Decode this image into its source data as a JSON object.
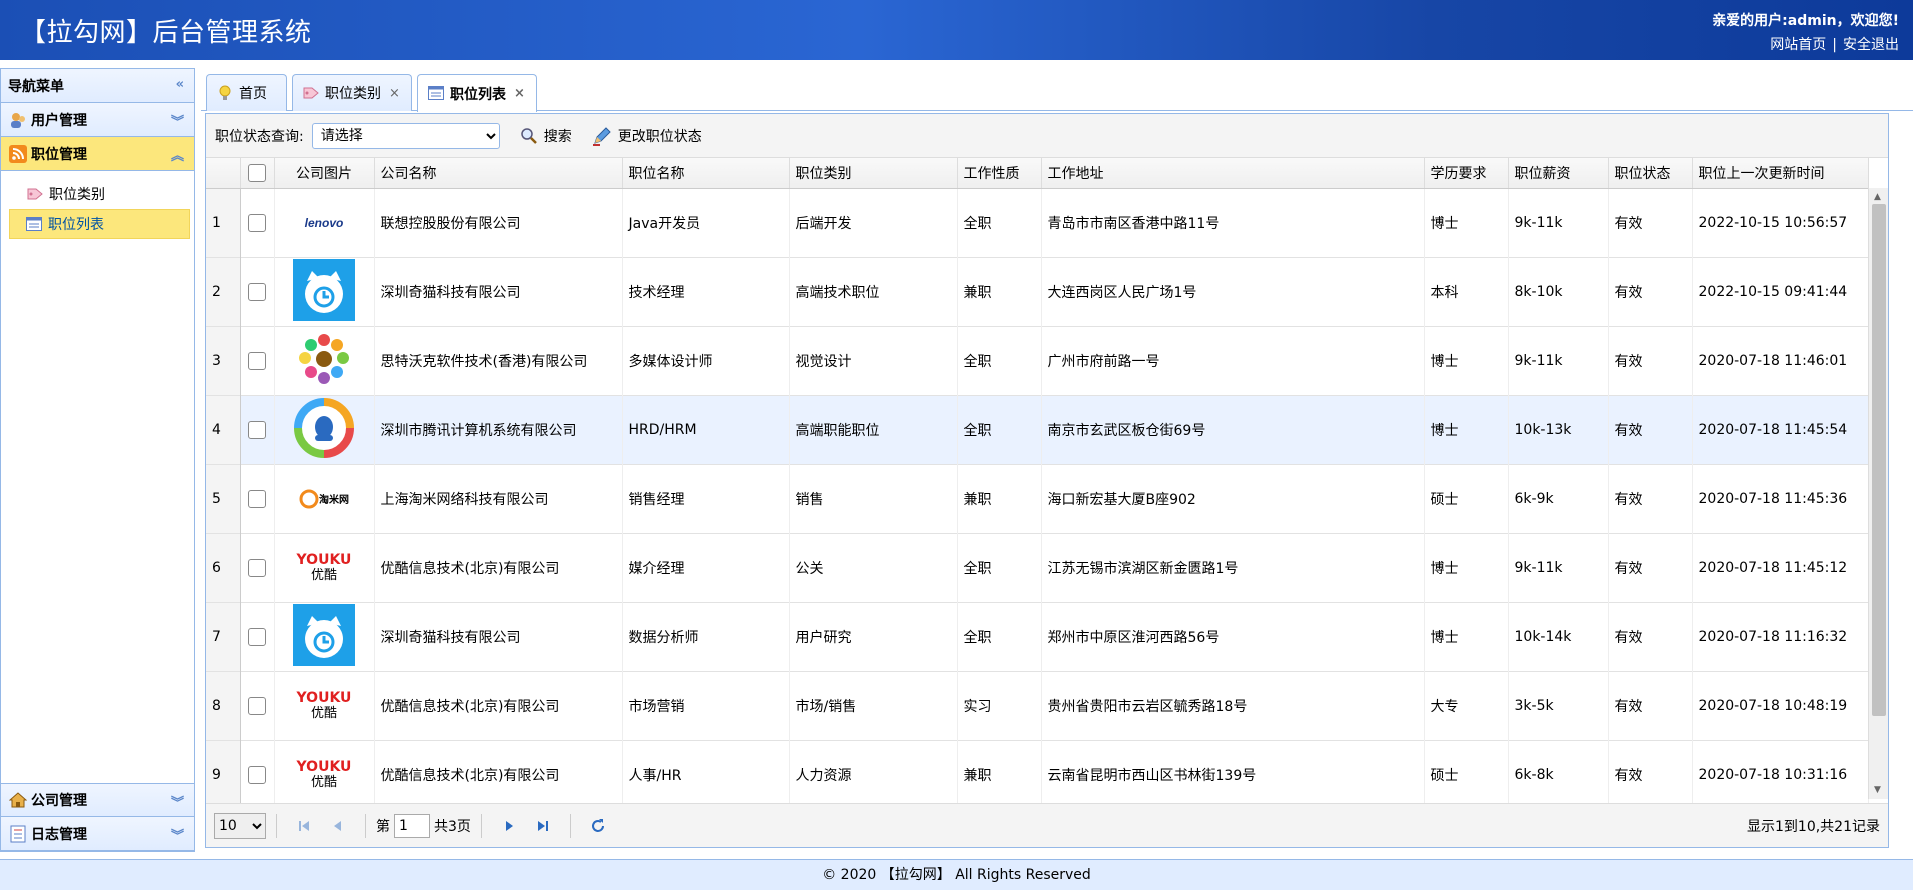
{
  "header": {
    "title": "【拉勾网】后台管理系统",
    "welcome": "亲爱的用户:admin，欢迎您!",
    "home_link": "网站首页",
    "separator": "|",
    "logout_link": "安全退出"
  },
  "sidebar": {
    "title": "导航菜单",
    "sections": [
      {
        "label": "用户管理"
      },
      {
        "label": "职位管理"
      },
      {
        "label": "公司管理"
      },
      {
        "label": "日志管理"
      }
    ],
    "sub_items": [
      {
        "label": "职位类别"
      },
      {
        "label": "职位列表"
      }
    ]
  },
  "tabs": [
    {
      "label": "首页"
    },
    {
      "label": "职位类别"
    },
    {
      "label": "职位列表"
    }
  ],
  "toolbar": {
    "status_label": "职位状态查询:",
    "status_select": "请选择",
    "search_label": "搜索",
    "change_status_label": "更改职位状态"
  },
  "table": {
    "columns": [
      "公司图片",
      "公司名称",
      "职位名称",
      "职位类别",
      "工作性质",
      "工作地址",
      "学历要求",
      "职位薪资",
      "职位状态",
      "职位上一次更新时间"
    ],
    "rows": [
      {
        "n": "1",
        "logo": "lenovo-logo",
        "company": "联想控股股份有限公司",
        "job": "Java开发员",
        "category": "后端开发",
        "nature": "全职",
        "address": "青岛市市南区香港中路11号",
        "edu": "博士",
        "salary": "9k-11k",
        "status": "有效",
        "time": "2022-10-15 10:56:57"
      },
      {
        "n": "2",
        "logo": "cat-clock-logo",
        "company": "深圳奇猫科技有限公司",
        "job": "技术经理",
        "category": "高端技术职位",
        "nature": "兼职",
        "address": "大连西岗区人民广场1号",
        "edu": "本科",
        "salary": "8k-10k",
        "status": "有效",
        "time": "2022-10-15 09:41:44"
      },
      {
        "n": "3",
        "logo": "colorful-dots-logo",
        "company": "思特沃克软件技术(香港)有限公司",
        "job": "多媒体设计师",
        "category": "视觉设计",
        "nature": "全职",
        "address": "广州市府前路一号",
        "edu": "博士",
        "salary": "9k-11k",
        "status": "有效",
        "time": "2020-07-18 11:46:01"
      },
      {
        "n": "4",
        "logo": "tencent-logo",
        "company": "深圳市腾讯计算机系统有限公司",
        "job": "HRD/HRM",
        "category": "高端职能职位",
        "nature": "全职",
        "address": "南京市玄武区板仓街69号",
        "edu": "博士",
        "salary": "10k-13k",
        "status": "有效",
        "time": "2020-07-18 11:45:54"
      },
      {
        "n": "5",
        "logo": "taomi-logo",
        "company": "上海淘米网络科技有限公司",
        "job": "销售经理",
        "category": "销售",
        "nature": "兼职",
        "address": "海口新宏基大厦B座902",
        "edu": "硕士",
        "salary": "6k-9k",
        "status": "有效",
        "time": "2020-07-18 11:45:36"
      },
      {
        "n": "6",
        "logo": "youku-logo",
        "company": "优酷信息技术(北京)有限公司",
        "job": "媒介经理",
        "category": "公关",
        "nature": "全职",
        "address": "江苏无锡市滨湖区新金匮路1号",
        "edu": "博士",
        "salary": "9k-11k",
        "status": "有效",
        "time": "2020-07-18 11:45:12"
      },
      {
        "n": "7",
        "logo": "cat-clock-logo",
        "company": "深圳奇猫科技有限公司",
        "job": "数据分析师",
        "category": "用户研究",
        "nature": "全职",
        "address": "郑州市中原区淮河西路56号",
        "edu": "博士",
        "salary": "10k-14k",
        "status": "有效",
        "time": "2020-07-18 11:16:32"
      },
      {
        "n": "8",
        "logo": "youku-logo",
        "company": "优酷信息技术(北京)有限公司",
        "job": "市场营销",
        "category": "市场/销售",
        "nature": "实习",
        "address": "贵州省贵阳市云岩区毓秀路18号",
        "edu": "大专",
        "salary": "3k-5k",
        "status": "有效",
        "time": "2020-07-18 10:48:19"
      },
      {
        "n": "9",
        "logo": "youku-logo",
        "company": "优酷信息技术(北京)有限公司",
        "job": "人事/HR",
        "category": "人力资源",
        "nature": "兼职",
        "address": "云南省昆明市西山区书林街139号",
        "edu": "硕士",
        "salary": "6k-8k",
        "status": "有效",
        "time": "2020-07-18 10:31:16"
      }
    ],
    "logo_text": {
      "lenovo": "lenovo",
      "youku": "YOUKU",
      "youku_cn": "优酷",
      "taomi": "淘米网"
    }
  },
  "pager": {
    "page_size": "10",
    "page_prefix": "第",
    "page_value": "1",
    "page_suffix": "共3页",
    "info": "显示1到10,共21记录"
  },
  "footer": {
    "text": "© 2020 【拉勾网】 All Rights Reserved"
  },
  "colors": {
    "header_blue": "#1b4fb5",
    "highlight_yellow": "#fce77c",
    "border_blue": "#95b8e7"
  }
}
